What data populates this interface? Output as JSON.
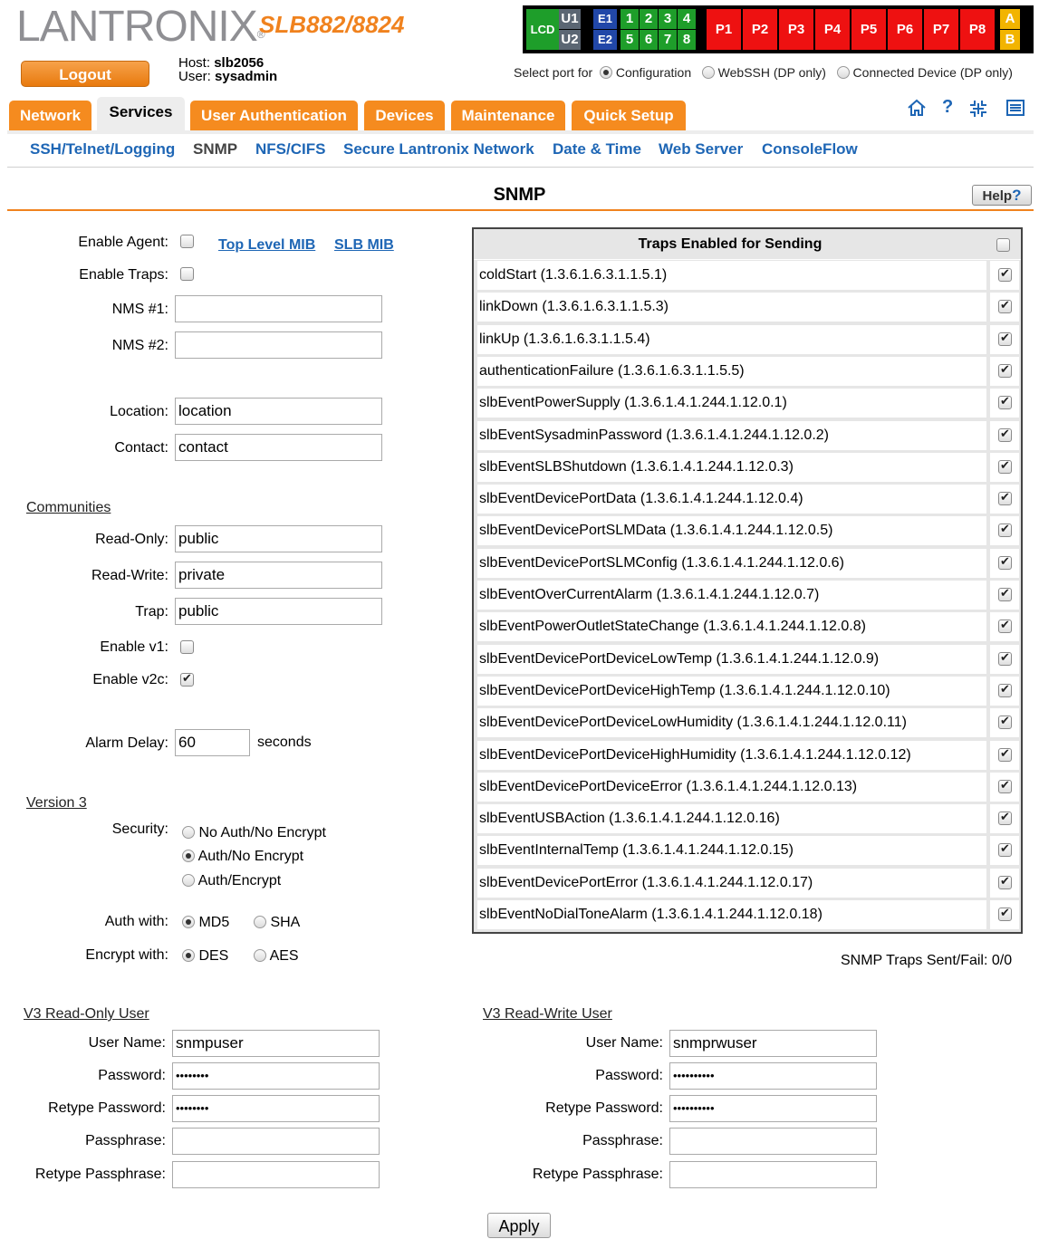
{
  "brand": {
    "logo": "LANTRONIX",
    "reg_mark": "®",
    "model": "SLB882/8824"
  },
  "session": {
    "logout_label": "Logout",
    "host_label": "Host:",
    "host_value": "slb2056",
    "user_label": "User:",
    "user_value": "sysadmin"
  },
  "port_status": {
    "lcd": "LCD",
    "u1": "U1",
    "u2": "U2",
    "e1": "E1",
    "e2": "E2",
    "device_ports": [
      "1",
      "2",
      "3",
      "4",
      "5",
      "6",
      "7",
      "8"
    ],
    "power_ports": [
      "P1",
      "P2",
      "P3",
      "P4",
      "P5",
      "P6",
      "P7",
      "P8"
    ],
    "a": "A",
    "b": "B",
    "select_port_label": "Select port for",
    "options": [
      {
        "label": "Configuration",
        "selected": true
      },
      {
        "label": "WebSSH (DP only)",
        "selected": false
      },
      {
        "label": "Connected Device (DP only)",
        "selected": false
      }
    ]
  },
  "tabs": [
    "Network",
    "Services",
    "User Authentication",
    "Devices",
    "Maintenance",
    "Quick Setup"
  ],
  "active_tab": "Services",
  "header_icons": [
    "home-icon",
    "question-icon",
    "expand-icon",
    "list-icon"
  ],
  "subnav": [
    "SSH/Telnet/Logging",
    "SNMP",
    "NFS/CIFS",
    "Secure Lantronix Network",
    "Date & Time",
    "Web Server",
    "ConsoleFlow"
  ],
  "page": {
    "title": "SNMP",
    "help_label": "Help",
    "help_mark": "?"
  },
  "agent": {
    "enable_agent_label": "Enable Agent:",
    "enable_agent": false,
    "top_level_mib": "Top Level MIB",
    "slb_mib": "SLB MIB",
    "enable_traps_label": "Enable Traps:",
    "enable_traps": false,
    "nms1_label": "NMS #1:",
    "nms1": "",
    "nms2_label": "NMS #2:",
    "nms2": "",
    "location_label": "Location:",
    "location": "location",
    "contact_label": "Contact:",
    "contact": "contact"
  },
  "communities": {
    "heading": "Communities",
    "read_only_label": "Read-Only:",
    "read_only": "public",
    "read_write_label": "Read-Write:",
    "read_write": "private",
    "trap_label": "Trap:",
    "trap": "public",
    "enable_v1_label": "Enable v1:",
    "enable_v1": false,
    "enable_v2c_label": "Enable v2c:",
    "enable_v2c": true,
    "alarm_delay_label": "Alarm Delay:",
    "alarm_delay": "60",
    "alarm_delay_unit": "seconds"
  },
  "version3": {
    "heading": "Version 3",
    "security_label": "Security:",
    "security_options": [
      "No Auth/No Encrypt",
      "Auth/No Encrypt",
      "Auth/Encrypt"
    ],
    "security_selected": 1,
    "auth_label": "Auth with:",
    "auth_options": [
      "MD5",
      "SHA"
    ],
    "auth_selected": 0,
    "encrypt_label": "Encrypt with:",
    "encrypt_options": [
      "DES",
      "AES"
    ],
    "encrypt_selected": 0
  },
  "traps": {
    "heading": "Traps Enabled for Sending",
    "select_all": false,
    "items": [
      "coldStart (1.3.6.1.6.3.1.1.5.1)",
      "linkDown (1.3.6.1.6.3.1.1.5.3)",
      "linkUp (1.3.6.1.6.3.1.1.5.4)",
      "authenticationFailure (1.3.6.1.6.3.1.1.5.5)",
      "slbEventPowerSupply (1.3.6.1.4.1.244.1.12.0.1)",
      "slbEventSysadminPassword (1.3.6.1.4.1.244.1.12.0.2)",
      "slbEventSLBShutdown (1.3.6.1.4.1.244.1.12.0.3)",
      "slbEventDevicePortData (1.3.6.1.4.1.244.1.12.0.4)",
      "slbEventDevicePortSLMData (1.3.6.1.4.1.244.1.12.0.5)",
      "slbEventDevicePortSLMConfig (1.3.6.1.4.1.244.1.12.0.6)",
      "slbEventOverCurrentAlarm (1.3.6.1.4.1.244.1.12.0.7)",
      "slbEventPowerOutletStateChange (1.3.6.1.4.1.244.1.12.0.8)",
      "slbEventDevicePortDeviceLowTemp (1.3.6.1.4.1.244.1.12.0.9)",
      "slbEventDevicePortDeviceHighTemp (1.3.6.1.4.1.244.1.12.0.10)",
      "slbEventDevicePortDeviceLowHumidity (1.3.6.1.4.1.244.1.12.0.11)",
      "slbEventDevicePortDeviceHighHumidity (1.3.6.1.4.1.244.1.12.0.12)",
      "slbEventDevicePortDeviceError (1.3.6.1.4.1.244.1.12.0.13)",
      "slbEventUSBAction (1.3.6.1.4.1.244.1.12.0.16)",
      "slbEventInternalTemp (1.3.6.1.4.1.244.1.12.0.15)",
      "slbEventDevicePortError (1.3.6.1.4.1.244.1.12.0.17)",
      "slbEventNoDialToneAlarm (1.3.6.1.4.1.244.1.12.0.18)"
    ],
    "checked": true,
    "sent_fail_label": "SNMP Traps Sent/Fail:",
    "sent_fail": "0/0"
  },
  "v3_ro_user": {
    "heading": "V3 Read-Only User",
    "user_name_label": "User Name:",
    "user_name": "snmpuser",
    "password_label": "Password:",
    "password": "••••••••",
    "retype_password_label": "Retype Password:",
    "retype_password": "••••••••",
    "passphrase_label": "Passphrase:",
    "passphrase": "",
    "retype_passphrase_label": "Retype Passphrase:",
    "retype_passphrase": ""
  },
  "v3_rw_user": {
    "heading": "V3 Read-Write User",
    "user_name_label": "User Name:",
    "user_name": "snmprwuser",
    "password_label": "Password:",
    "password": "••••••••••",
    "retype_password_label": "Retype Password:",
    "retype_password": "••••••••••",
    "passphrase_label": "Passphrase:",
    "passphrase": "",
    "retype_passphrase_label": "Retype Passphrase:",
    "retype_passphrase": ""
  },
  "apply_label": "Apply",
  "colors": {
    "accent_orange": "#f58b1f",
    "link_blue": "#1e66b5",
    "port_green": "#1e9e2a",
    "port_red": "#ee1111"
  }
}
